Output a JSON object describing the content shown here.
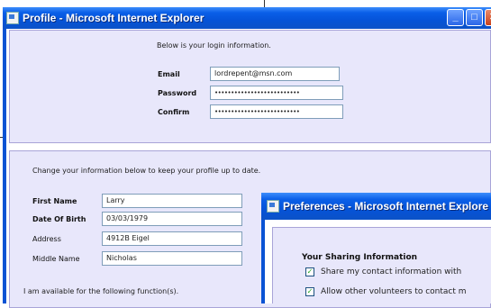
{
  "profile_window": {
    "title": "Profile - Microsoft Internet Explorer",
    "login": {
      "intro": "Below is your login information.",
      "email_label": "Email",
      "email_value": "lordrepent@msn.com",
      "password_label": "Password",
      "password_value": "••••••••••••••••••••••••••",
      "confirm_label": "Confirm",
      "confirm_value": "••••••••••••••••••••••••••"
    },
    "info": {
      "intro": "Change your information below to keep your profile up to date.",
      "first_name_label": "First Name",
      "first_name_value": "Larry",
      "dob_label": "Date Of Birth",
      "dob_value": "03/03/1979",
      "address_label": "Address",
      "address_value": "4912B Eigel",
      "middle_name_label": "Middle Name",
      "middle_name_value": "Nicholas",
      "functions_text": "I am available for the following function(s)."
    }
  },
  "preferences_window": {
    "title": "Preferences - Microsoft Internet Explore",
    "sharing_heading": "Your Sharing Information",
    "options": [
      {
        "label": "Share my contact information with",
        "checked": true
      },
      {
        "label": "Allow other volunteers to contact m",
        "checked": true
      }
    ]
  },
  "colors": {
    "xp_blue": "#0a53d4",
    "panel_bg": "#e8e7fb",
    "panel_border": "#a8a4d8"
  }
}
